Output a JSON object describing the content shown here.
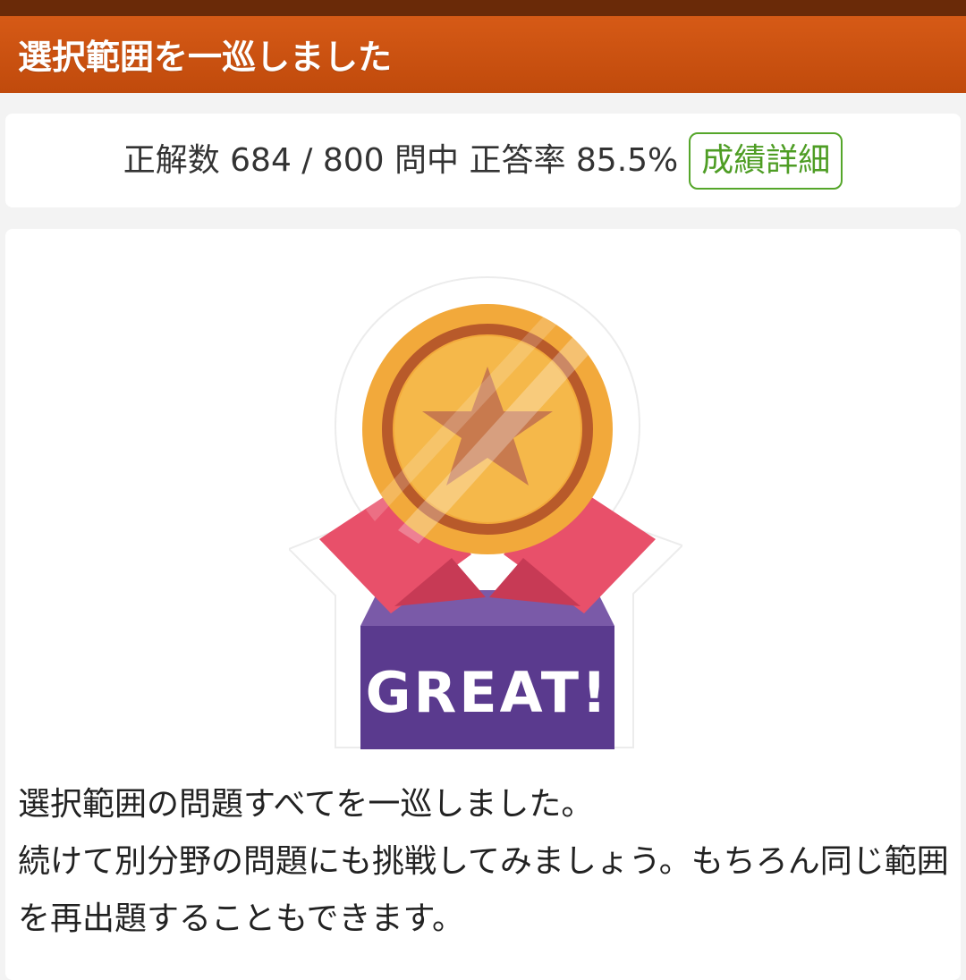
{
  "header": {
    "title": "選択範囲を一巡しました"
  },
  "score": {
    "summary": "正解数 684 / 800 問中 正答率 85.5%",
    "correct": 684,
    "total": 800,
    "rate_percent": 85.5,
    "detail_button_label": "成績詳細"
  },
  "badge": {
    "icon": "medal-star-icon",
    "banner_text": "GREAT!"
  },
  "message": {
    "line1": "選択範囲の問題すべてを一巡しました。",
    "line2": "続けて別分野の問題にも挑戦してみましょう。もちろん同じ範囲を再出題することもできます。"
  },
  "colors": {
    "header_bar": "#c9510f",
    "header_top_strip": "#6a2a08",
    "accent_green": "#55a62a",
    "medal_gold": "#f2a93b",
    "ribbon_pink": "#e8506a",
    "banner_purple": "#5a3a8e"
  }
}
